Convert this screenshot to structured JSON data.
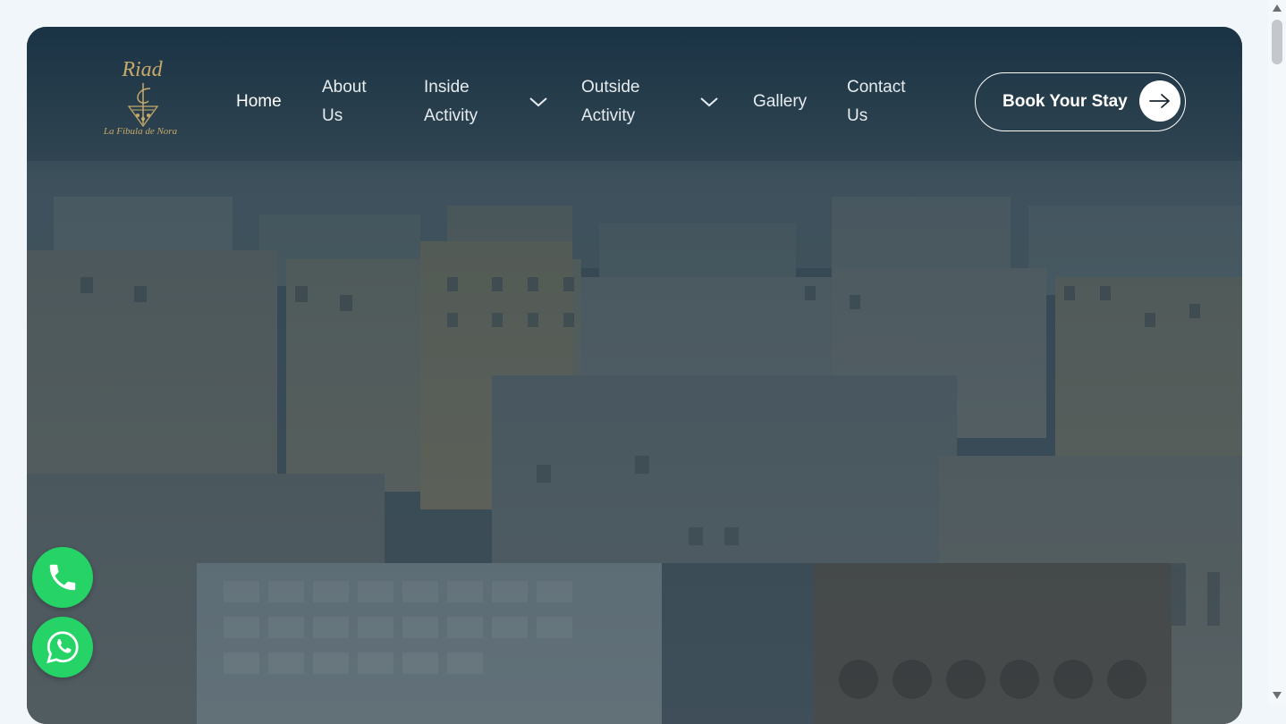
{
  "brand": {
    "logo_top": "Riad",
    "logo_bottom": "La Fibula de Nora",
    "logo_color": "#c7a96a"
  },
  "nav": {
    "home": "Home",
    "about_line1": "About",
    "about_line2": "Us",
    "inside_line1": "Inside",
    "inside_line2": "Activity",
    "outside_line1": "Outside",
    "outside_line2": "Activity",
    "gallery": "Gallery",
    "contact_line1": "Contact",
    "contact_line2": "Us"
  },
  "cta": {
    "book_label": "Book Your Stay",
    "arrow_icon": "arrow-right-icon"
  },
  "floating": {
    "phone_icon": "phone-icon",
    "whatsapp_icon": "whatsapp-icon",
    "accent": "#25d366"
  },
  "hero": {
    "image": "aerial view of old medina city tanneries"
  }
}
